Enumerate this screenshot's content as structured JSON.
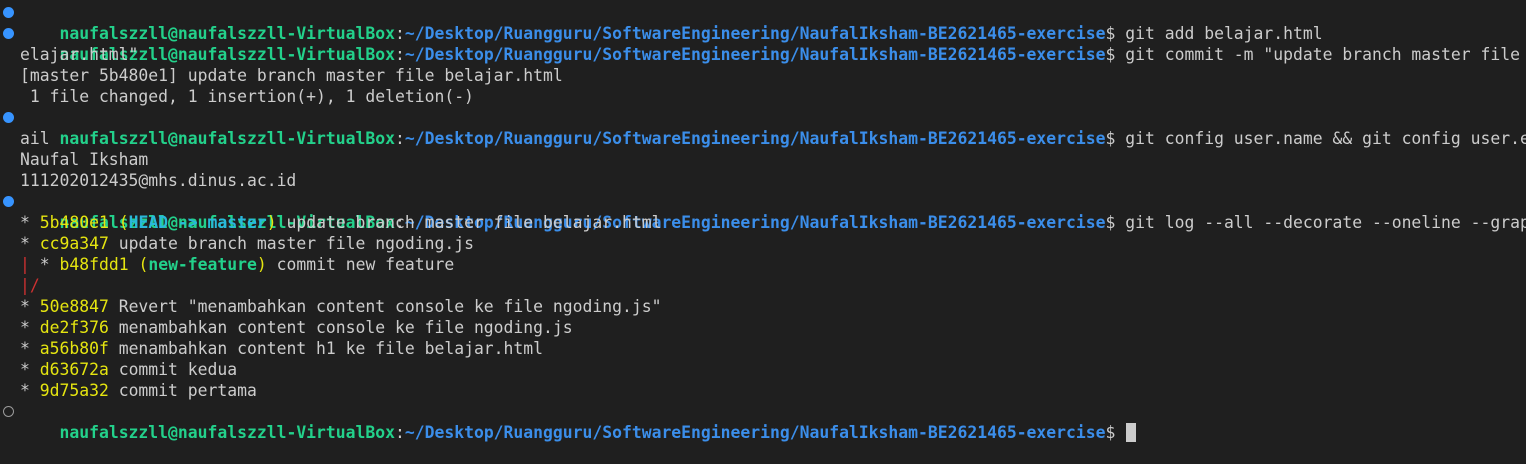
{
  "prompt": {
    "user": "naufalszzll@naufalszzll-VirtualBox",
    "colon": ":",
    "path": "~/Desktop/Ruangguru/SoftwareEngineering/NaufalIksham-BE2621465-exercise",
    "dollar": "$"
  },
  "commands": {
    "add": " git add belajar.html",
    "commit_line1": " git commit -m \"update branch master file b",
    "commit_line2": "elajar.html\"",
    "config_line1": " git config user.name && git config user.em",
    "config_line2": "ail",
    "log": " git log --all --decorate --oneline --graph"
  },
  "outputs": {
    "commit_result": "[master 5b480e1] update branch master file belajar.html",
    "commit_stats": " 1 file changed, 1 insertion(+), 1 deletion(-)",
    "user_name": "Naufal Iksham",
    "user_email": "111202012435@mhs.dinus.ac.id"
  },
  "log": {
    "c1": {
      "graph": "* ",
      "hash": "5b480e1",
      "open": " (",
      "head": "HEAD -> master",
      "close": ")",
      "msg": " update branch master file belajar.html"
    },
    "c2": {
      "graph": "* ",
      "hash": "cc9a347",
      "msg": " update branch master file ngoding.js"
    },
    "c3": {
      "pipe": "| ",
      "graph": "* ",
      "hash": "b48fdd1",
      "open": " (",
      "branch": "new-feature",
      "close": ")",
      "msg": " commit new feature"
    },
    "merge": "|/",
    "c4": {
      "graph": "* ",
      "hash": "50e8847",
      "msg": " Revert \"menambahkan content console ke file ngoding.js\""
    },
    "c5": {
      "graph": "* ",
      "hash": "de2f376",
      "msg": " menambahkan content console ke file ngoding.js"
    },
    "c6": {
      "graph": "* ",
      "hash": "a56b80f",
      "msg": " menambahkan content h1 ke file belajar.html"
    },
    "c7": {
      "graph": "* ",
      "hash": "d63672a",
      "msg": " commit kedua"
    },
    "c8": {
      "graph": "* ",
      "hash": "9d75a32",
      "msg": " commit pertama"
    }
  },
  "colors": {
    "background": "#1f1f1f",
    "user": "#23d18b",
    "path": "#3b8eea",
    "hash": "#e5e510",
    "head": "#29b8db",
    "graph_pipe": "#cd3131",
    "decoration_success": "#3794ff"
  }
}
